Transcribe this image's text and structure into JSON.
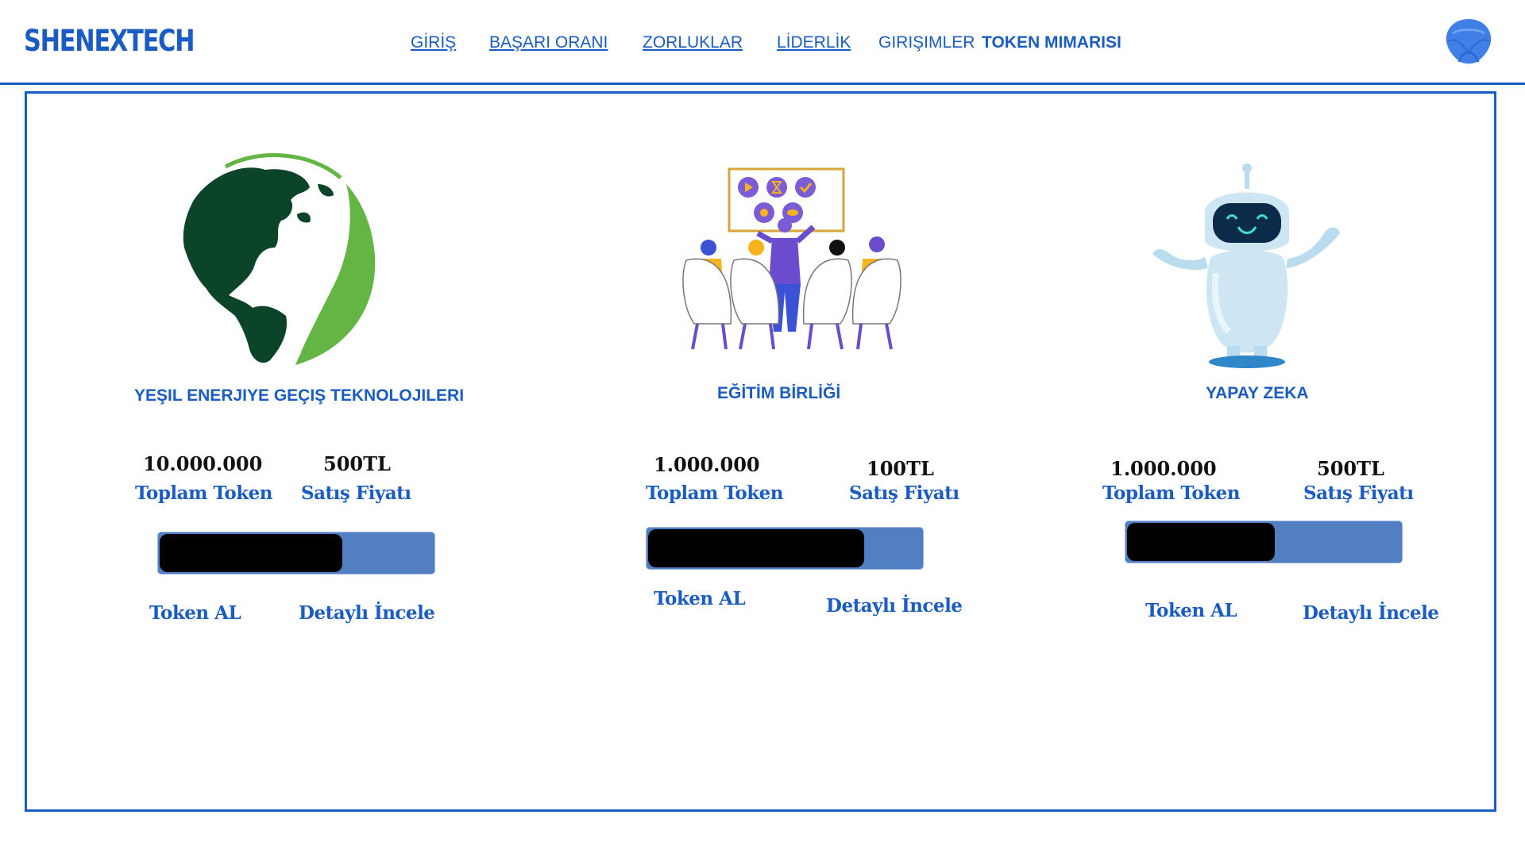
{
  "header": {
    "logo": "SHENEXTECH",
    "nav": [
      {
        "label": "GİRİŞ",
        "style": "link"
      },
      {
        "label": "BAŞARI ORANI",
        "style": "link"
      },
      {
        "label": "ZORLUKLAR",
        "style": "link"
      },
      {
        "label": "LİDERLİK",
        "style": "link"
      },
      {
        "label": "GIRIŞIMLER",
        "style": "plain"
      },
      {
        "label": "TOKEN MIMARISI",
        "style": "bold"
      }
    ],
    "avatar_icon": "avatar-shell-icon"
  },
  "colors": {
    "brand": "#1a5cc4",
    "bar_track": "#527fc2",
    "bar_fill": "#000000",
    "earth": "#0b4428",
    "leaf": "#63b544"
  },
  "cards": [
    {
      "title": "YEŞIL ENERJIYE GEÇIŞ TEKNOLOJILERI",
      "icon": "green-earth-leaf-icon",
      "total_tokens": "10.000.000",
      "total_label": "Toplam Token",
      "price": "500TL",
      "price_label": "Satış Fiyatı",
      "progress": 0.67,
      "buy_label": "Token AL",
      "details_label": "Detaylı İncele"
    },
    {
      "title": "EĞİTİM BİRLİĞİ",
      "icon": "education-meeting-icon",
      "total_tokens": "1.000.000",
      "total_label": "Toplam Token",
      "price": "100TL",
      "price_label": "Satış Fiyatı",
      "progress": 0.79,
      "buy_label": "Token AL",
      "details_label": "Detaylı İncele"
    },
    {
      "title": "YAPAY ZEKA",
      "icon": "ai-robot-icon",
      "total_tokens": "1.000.000",
      "total_label": "Toplam Token",
      "price": "500TL",
      "price_label": "Satış Fiyatı",
      "progress": 0.54,
      "buy_label": "Token AL",
      "details_label": "Detaylı İncele"
    }
  ]
}
